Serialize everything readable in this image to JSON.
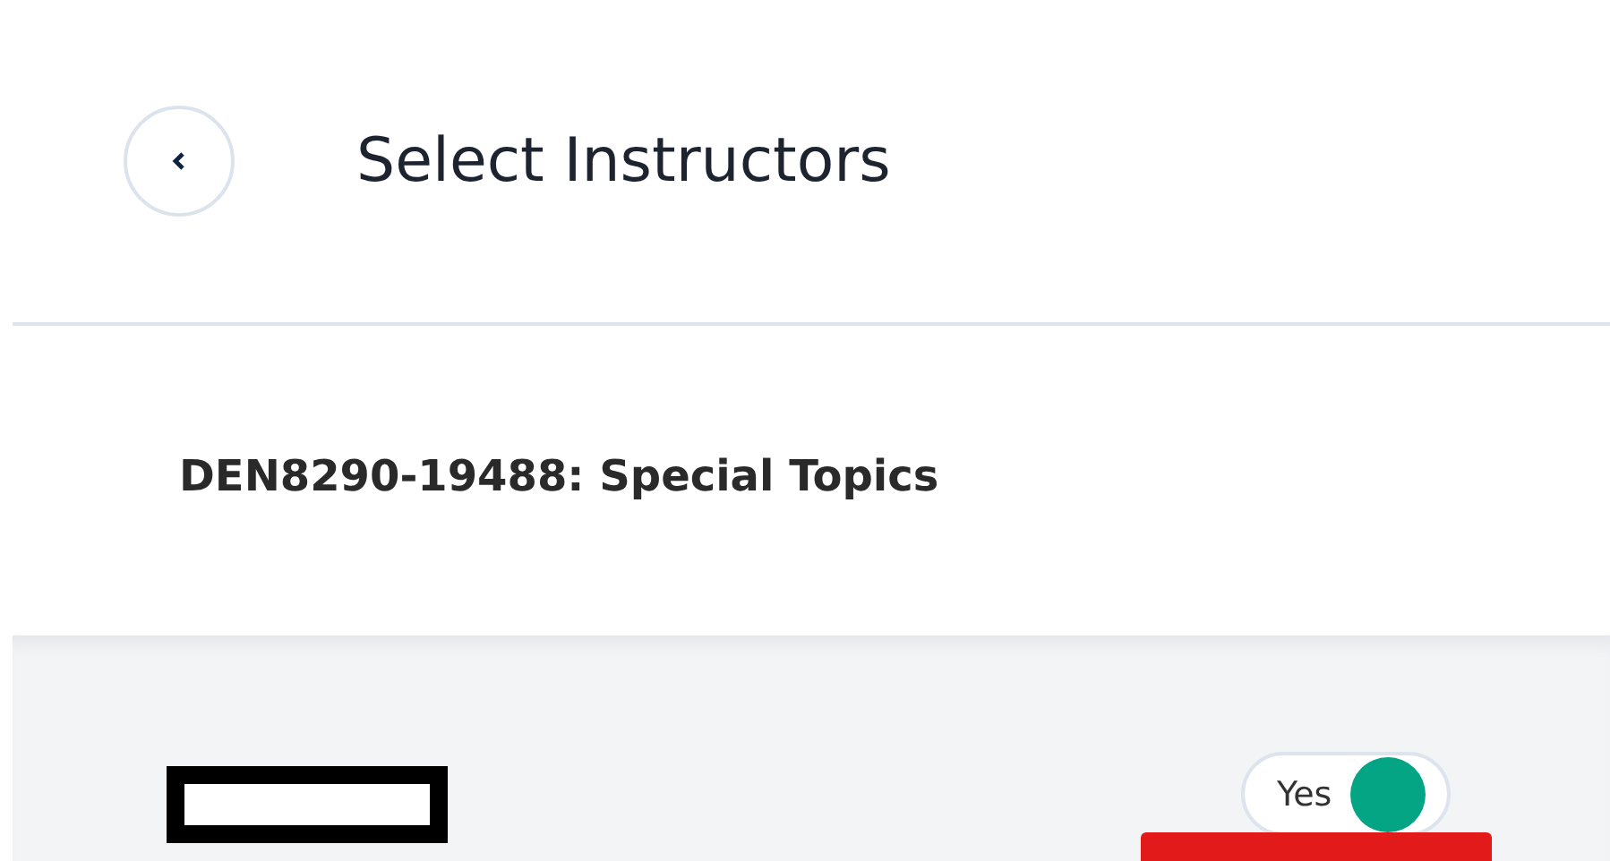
{
  "header": {
    "title": "Select Instructors"
  },
  "course": {
    "title": "DEN8290-19488: Special Topics"
  },
  "instructor": {
    "toggle": {
      "label": "Yes",
      "on": true
    }
  }
}
